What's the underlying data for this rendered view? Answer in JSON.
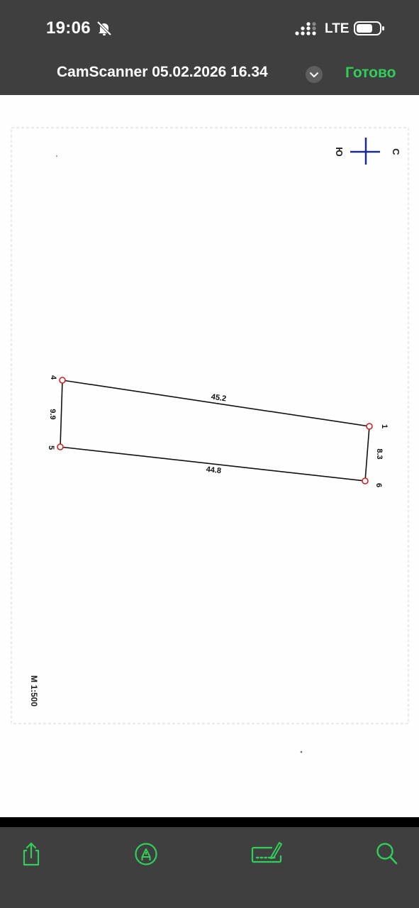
{
  "status": {
    "time": "19:06",
    "network": "LTE",
    "icons": [
      "bell-slash-icon",
      "signal-icon",
      "battery-icon"
    ]
  },
  "header": {
    "title": "CamScanner 05.02.2026 16.34",
    "done_label": "Готово",
    "accent_color": "#2fcf5a"
  },
  "drawing": {
    "compass": {
      "north_label": "С",
      "south_label": "Ю"
    },
    "points": [
      {
        "label": "1"
      },
      {
        "label": "4"
      },
      {
        "label": "5"
      },
      {
        "label": "6"
      }
    ],
    "edges": [
      {
        "label": "45.2"
      },
      {
        "label": "9.9"
      },
      {
        "label": "44.8"
      },
      {
        "label": "8.3"
      }
    ],
    "scale_label": "М 1:500",
    "point_color": "#cc2222"
  },
  "toolbar": {
    "items": [
      "share-icon",
      "markup-icon",
      "signature-icon",
      "search-icon"
    ]
  }
}
